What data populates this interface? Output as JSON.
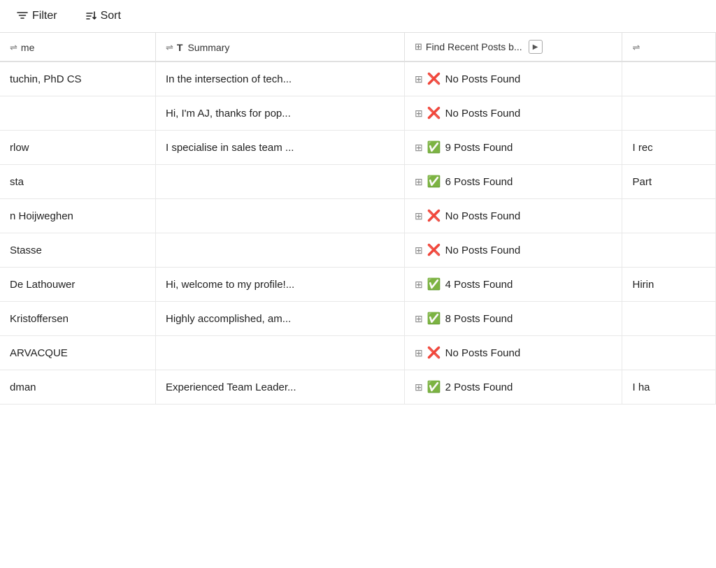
{
  "toolbar": {
    "filter_label": "Filter",
    "sort_label": "Sort"
  },
  "table": {
    "columns": [
      {
        "id": "name",
        "label": "Name",
        "icon": "sort-rows-icon"
      },
      {
        "id": "summary",
        "label": "Summary",
        "icon": "sort-rows-icon",
        "type_icon": "T"
      },
      {
        "id": "posts",
        "label": "Find Recent Posts b...",
        "icon": "grid-icon",
        "has_play": true
      },
      {
        "id": "extra",
        "label": "",
        "icon": "sort-rows-icon"
      }
    ],
    "rows": [
      {
        "name": "tuchin, PhD CS",
        "summary": "In the intersection of tech...",
        "posts_status": "no",
        "posts_text": "No Posts Found",
        "extra": ""
      },
      {
        "name": "",
        "summary": "Hi, I'm AJ, thanks for pop...",
        "posts_status": "no",
        "posts_text": "No Posts Found",
        "extra": ""
      },
      {
        "name": "rlow",
        "summary": "I specialise in sales team ...",
        "posts_status": "yes",
        "posts_text": "9 Posts Found",
        "extra": "I rec"
      },
      {
        "name": "sta",
        "summary": "",
        "posts_status": "yes",
        "posts_text": "6 Posts Found",
        "extra": "Part"
      },
      {
        "name": "n Hoijweghen",
        "summary": "",
        "posts_status": "no",
        "posts_text": "No Posts Found",
        "extra": ""
      },
      {
        "name": "Stasse",
        "summary": "",
        "posts_status": "no",
        "posts_text": "No Posts Found",
        "extra": ""
      },
      {
        "name": "De Lathouwer",
        "summary": "Hi, welcome to my profile!...",
        "posts_status": "yes",
        "posts_text": "4 Posts Found",
        "extra": "Hirin"
      },
      {
        "name": "Kristoffersen",
        "summary": "Highly accomplished, am...",
        "posts_status": "yes",
        "posts_text": "8 Posts Found",
        "extra": ""
      },
      {
        "name": "ARVACQUE",
        "summary": "",
        "posts_status": "no",
        "posts_text": "No Posts Found",
        "extra": ""
      },
      {
        "name": "dman",
        "summary": "Experienced Team Leader...",
        "posts_status": "yes",
        "posts_text": "2 Posts Found",
        "extra": "I ha"
      }
    ],
    "status_icons": {
      "yes": "✅",
      "no": "❌"
    }
  }
}
